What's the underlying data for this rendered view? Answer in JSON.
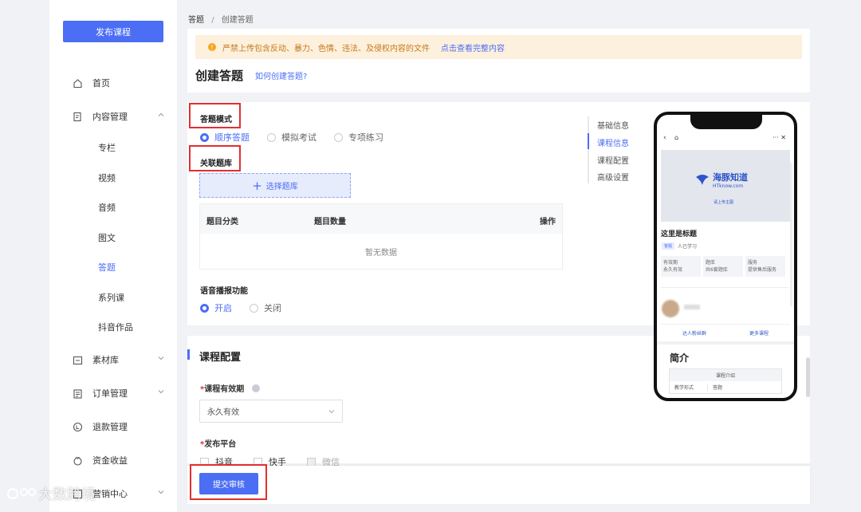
{
  "sidebar": {
    "publish_label": "发布课程",
    "items": [
      {
        "label": "首页",
        "icon": "home-icon"
      },
      {
        "label": "内容管理",
        "icon": "document-icon"
      },
      {
        "label": "素材库",
        "icon": "folder-icon"
      },
      {
        "label": "订单管理",
        "icon": "clipboard-icon"
      },
      {
        "label": "退款管理",
        "icon": "refund-icon"
      },
      {
        "label": "资金收益",
        "icon": "wallet-icon"
      },
      {
        "label": "营销中心",
        "icon": "marketing-icon"
      }
    ],
    "sub_items": [
      "专栏",
      "视频",
      "音频",
      "图文",
      "答题",
      "系列课",
      "抖音作品"
    ]
  },
  "breadcrumb": {
    "root": "答题",
    "sep": "/",
    "current": "创建答题"
  },
  "notice": {
    "text": "严禁上传包含反动、暴力、色情、违法、及侵权内容的文件",
    "link": "点击查看完整内容"
  },
  "page": {
    "title": "创建答题",
    "help_link": "如何创建答题?"
  },
  "quiz_mode": {
    "label": "答题模式",
    "options": [
      "顺序答题",
      "模拟考试",
      "专项练习"
    ],
    "selected": "顺序答题"
  },
  "question_bank": {
    "label": "关联题库",
    "select_button": "选择题库",
    "table": {
      "headers": [
        "题目分类",
        "题目数量",
        "操作"
      ],
      "empty": "暂无数据"
    }
  },
  "voice": {
    "label": "语音播报功能",
    "options": [
      "开启",
      "关闭"
    ],
    "selected": "开启"
  },
  "anchors": [
    "基础信息",
    "课程信息",
    "课程配置",
    "高级设置"
  ],
  "anchors_active": "课程信息",
  "config": {
    "title": "课程配置",
    "validity_label": "课程有效期",
    "validity_value": "永久有效",
    "platform_label": "发布平台",
    "platforms": [
      "抖音",
      "快手",
      "微信"
    ]
  },
  "submit_label": "提交审核",
  "phone": {
    "logo_text": "海豚知道",
    "logo_sub": "HTknow.com",
    "title": "这里是标题",
    "tag": "答题",
    "learners": "人已学习",
    "features": [
      "有效期",
      "永久有效",
      "题库",
      "共6套题库",
      "服务",
      "提供售后服务"
    ],
    "join_left": "达人粉丝群",
    "join_right": "更多课程",
    "intro_title": "简介",
    "table_header": "课程介绍",
    "table_cells": [
      "教学形式",
      "答题"
    ]
  },
  "watermark": "大数跨境",
  "colors": {
    "primary": "#4b6ef5",
    "notice_bg": "#fdf0dd",
    "notice_icon": "#f5a623",
    "highlight": "#e32f2f"
  }
}
